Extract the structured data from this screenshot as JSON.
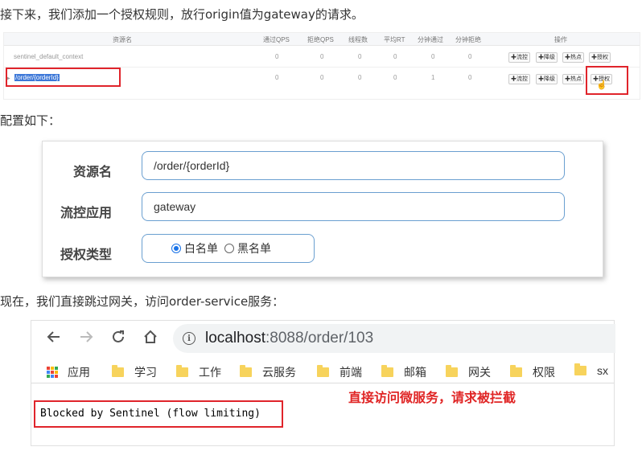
{
  "paragraphs": {
    "p1": "接下来，我们添加一个授权规则，放行origin值为gateway的请求。",
    "p2": "配置如下：",
    "p3": "现在，我们直接跳过网关，访问order-service服务："
  },
  "sentinel_table": {
    "headers": [
      "资源名",
      "通过QPS",
      "拒绝QPS",
      "线程数",
      "平均RT",
      "分钟通过",
      "分钟拒绝",
      "操作"
    ],
    "rows": [
      {
        "name": "sentinel_default_context",
        "values": [
          "0",
          "0",
          "0",
          "0",
          "0",
          "0"
        ]
      },
      {
        "name": "/order/{orderId}",
        "values": [
          "0",
          "0",
          "0",
          "0",
          "1",
          "0"
        ]
      }
    ],
    "actions": [
      "✚流控",
      "✚降级",
      "✚热点",
      "✚授权"
    ]
  },
  "auth_form": {
    "resource_label": "资源名",
    "resource_value": "/order/{orderId}",
    "app_label": "流控应用",
    "app_value": "gateway",
    "type_label": "授权类型",
    "options": [
      "白名单",
      "黑名单"
    ],
    "selected": "白名单"
  },
  "browser": {
    "url_host": "localhost",
    "url_rest": ":8088/order/103",
    "bookmarks": [
      "应用",
      "学习",
      "工作",
      "云服务",
      "前端",
      "邮箱",
      "网关",
      "权限",
      "sx"
    ],
    "page_text": "Blocked by Sentinel (flow limiting)",
    "annotation": "直接访问微服务，请求被拦截",
    "annotation_color": "#e02525",
    "highlight_color": "#e0242b"
  }
}
